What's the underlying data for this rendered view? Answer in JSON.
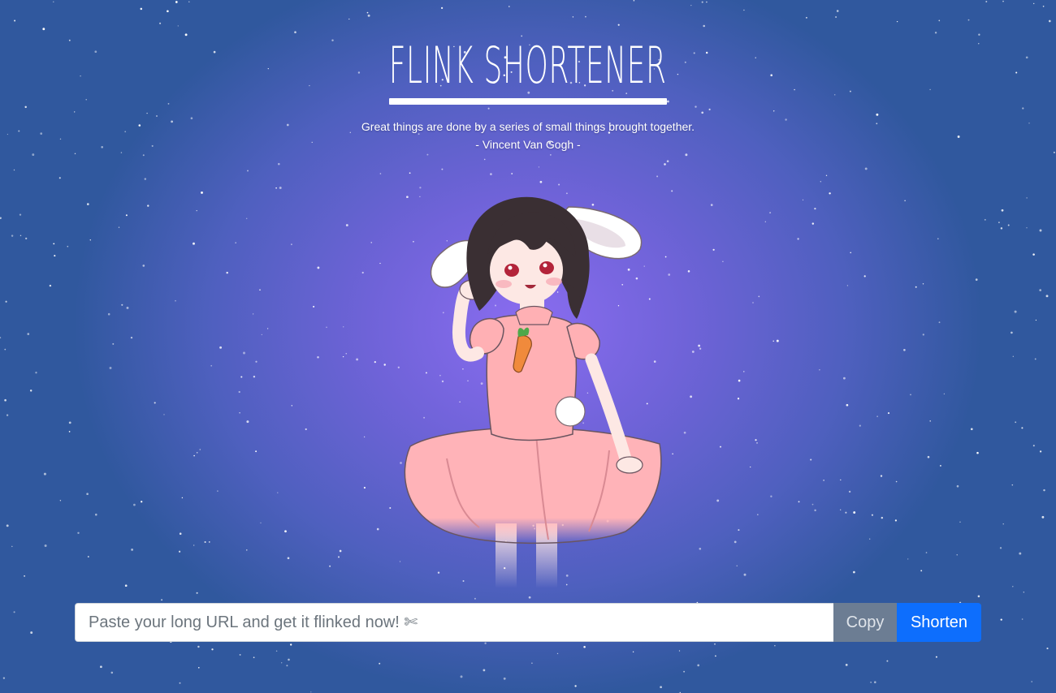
{
  "app": {
    "title": "FLINK SHORTENER",
    "quote_line": "Great things are done by a series of small things brought together.",
    "quote_author": "- Vincent Van Gogh -"
  },
  "form": {
    "placeholder": "Paste your long URL and get it flinked now! ✄",
    "value": "",
    "copy_label": "Copy",
    "shorten_label": "Shorten"
  },
  "colors": {
    "shorten_button": "#0d6efd",
    "copy_button": "#6c7d93",
    "background_center": "#8a6cf0",
    "background_edge": "#30589e"
  },
  "illustration": {
    "description_icon": "bunny-girl-illustration"
  }
}
